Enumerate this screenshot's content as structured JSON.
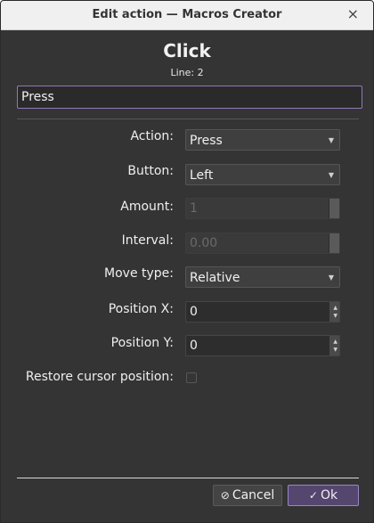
{
  "window": {
    "title": "Edit action — Macros Creator",
    "close_glyph": "×"
  },
  "header": {
    "title": "Click",
    "line": "Line: 2"
  },
  "name_field": {
    "value": "Press"
  },
  "form": {
    "action": {
      "label": "Action:",
      "value": "Press"
    },
    "button": {
      "label": "Button:",
      "value": "Left"
    },
    "amount": {
      "label": "Amount:",
      "value": "1",
      "enabled": false
    },
    "interval": {
      "label": "Interval:",
      "value": "0.00",
      "enabled": false
    },
    "move_type": {
      "label": "Move type:",
      "value": "Relative"
    },
    "position_x": {
      "label": "Position X:",
      "value": "0"
    },
    "position_y": {
      "label": "Position Y:",
      "value": "0"
    },
    "restore_cursor": {
      "label": "Restore cursor position:",
      "checked": false
    }
  },
  "footer": {
    "cancel_label": "Cancel",
    "ok_label": "Ok",
    "cancel_icon": "cancel-circle-icon",
    "ok_icon": "checkmark-icon"
  },
  "colors": {
    "window_bg": "#343434",
    "accent": "#8e7ab8",
    "ok_bg": "#55466f"
  }
}
